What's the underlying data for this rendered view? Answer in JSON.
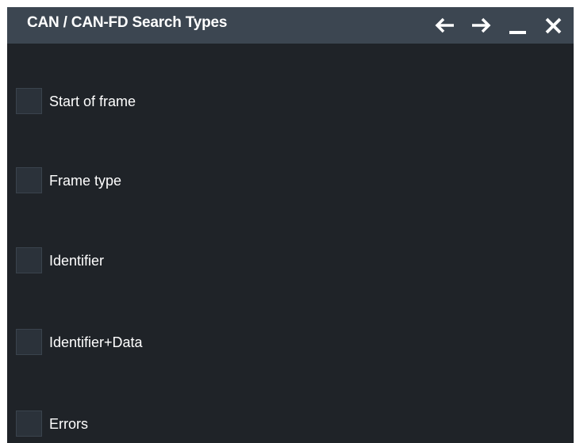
{
  "dialog": {
    "title": "CAN / CAN-FD Search Types",
    "buttons": {
      "back": "arrow-left-icon",
      "forward": "arrow-right-icon",
      "minimize": "minimize-icon",
      "close": "close-icon"
    }
  },
  "options": [
    {
      "label": "Start of frame",
      "checked": false
    },
    {
      "label": "Frame type",
      "checked": false
    },
    {
      "label": "Identifier",
      "checked": false
    },
    {
      "label": "Identifier+Data",
      "checked": false
    },
    {
      "label": "Errors",
      "checked": false
    }
  ],
  "colors": {
    "titlebar": "#3c4651",
    "background": "#1f2328",
    "checkbox": "#2b323a",
    "text": "#ffffff"
  }
}
